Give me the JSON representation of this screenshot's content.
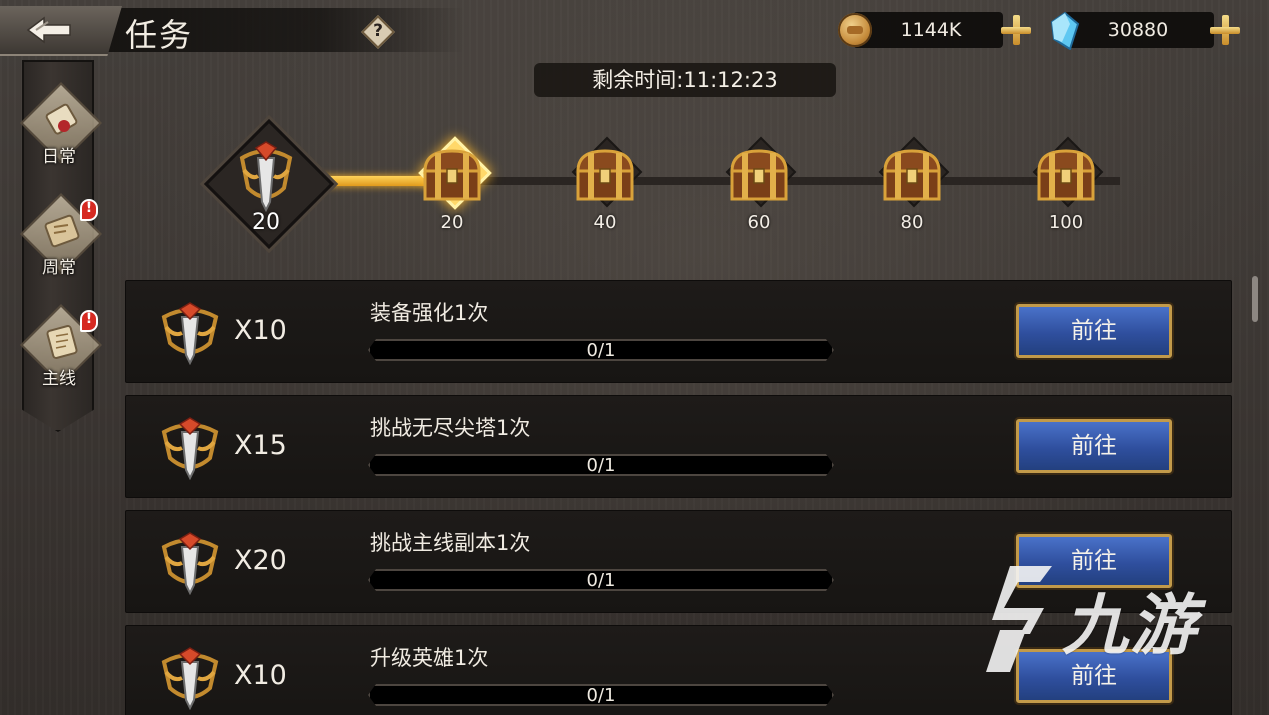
{
  "header": {
    "title": "任务",
    "help_label": "?",
    "gold": "1144K",
    "gems": "30880"
  },
  "timer": "剩余时间:11:12:23",
  "tabs": [
    {
      "label": "日常",
      "alert": false
    },
    {
      "label": "周常",
      "alert": true
    },
    {
      "label": "主线",
      "alert": true
    }
  ],
  "progress": {
    "current": "20",
    "current_value": 20,
    "max_value": 100,
    "milestones": [
      "20",
      "40",
      "60",
      "80",
      "100"
    ]
  },
  "tasks": [
    {
      "reward": "X10",
      "name": "装备强化1次",
      "progress": "0/1",
      "button": "前往"
    },
    {
      "reward": "X15",
      "name": "挑战无尽尖塔1次",
      "progress": "0/1",
      "button": "前往"
    },
    {
      "reward": "X20",
      "name": "挑战主线副本1次",
      "progress": "0/1",
      "button": "前往"
    },
    {
      "reward": "X10",
      "name": "升级英雄1次",
      "progress": "0/1",
      "button": "前往"
    }
  ],
  "alert_mark": "!",
  "watermark": "九游",
  "icons": {
    "back": "back-arrow-icon",
    "gold": "gold-coin-icon",
    "gem": "blue-gem-icon",
    "add": "plus-icon",
    "chest": "treasure-chest-icon",
    "medal": "activity-medal-icon"
  },
  "colors": {
    "accent_gold": "#f5b02c",
    "button_blue": "#2f4f9e",
    "alert_red": "#d62a22"
  }
}
